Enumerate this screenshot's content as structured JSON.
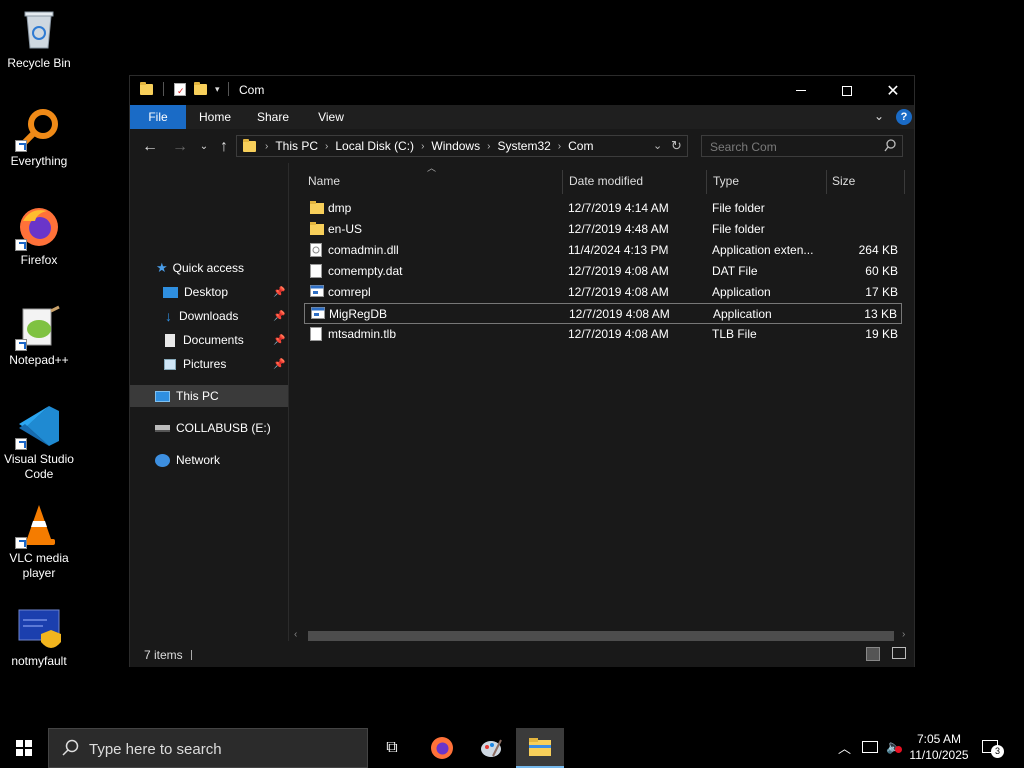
{
  "desktop": {
    "icons": [
      {
        "label": "Recycle Bin"
      },
      {
        "label": "Everything"
      },
      {
        "label": "Firefox"
      },
      {
        "label": "Notepad++"
      },
      {
        "label": "Visual Studio Code"
      },
      {
        "label": "VLC media player"
      },
      {
        "label": "notmyfault"
      }
    ]
  },
  "window": {
    "title": "Com",
    "ribbon": {
      "tabs": [
        "File",
        "Home",
        "Share",
        "View"
      ]
    },
    "address": {
      "crumbs": [
        "This PC",
        "Local Disk (C:)",
        "Windows",
        "System32",
        "Com"
      ]
    },
    "search": {
      "placeholder": "Search Com"
    },
    "nav": {
      "quick_access": "Quick access",
      "items": [
        "Desktop",
        "Downloads",
        "Documents",
        "Pictures"
      ],
      "this_pc": "This PC",
      "usb": "COLLABUSB (E:)",
      "network": "Network"
    },
    "columns": {
      "name": "Name",
      "date": "Date modified",
      "type": "Type",
      "size": "Size"
    },
    "files": [
      {
        "name": "dmp",
        "date": "12/7/2019 4:14 AM",
        "type": "File folder",
        "size": "",
        "icon": "folder"
      },
      {
        "name": "en-US",
        "date": "12/7/2019 4:48 AM",
        "type": "File folder",
        "size": "",
        "icon": "folder"
      },
      {
        "name": "comadmin.dll",
        "date": "11/4/2024 4:13 PM",
        "type": "Application exten...",
        "size": "264 KB",
        "icon": "dll"
      },
      {
        "name": "comempty.dat",
        "date": "12/7/2019 4:08 AM",
        "type": "DAT File",
        "size": "60 KB",
        "icon": "file"
      },
      {
        "name": "comrepl",
        "date": "12/7/2019 4:08 AM",
        "type": "Application",
        "size": "17 KB",
        "icon": "app"
      },
      {
        "name": "MigRegDB",
        "date": "12/7/2019 4:08 AM",
        "type": "Application",
        "size": "13 KB",
        "icon": "app"
      },
      {
        "name": "mtsadmin.tlb",
        "date": "12/7/2019 4:08 AM",
        "type": "TLB File",
        "size": "19 KB",
        "icon": "file"
      }
    ],
    "status": {
      "count": "7 items"
    }
  },
  "taskbar": {
    "search_placeholder": "Type here to search",
    "time": "7:05 AM",
    "date": "11/10/2025",
    "notifications": "3"
  },
  "colors": {
    "accent": "#1a6bc6",
    "folder": "#f7cf5a"
  }
}
